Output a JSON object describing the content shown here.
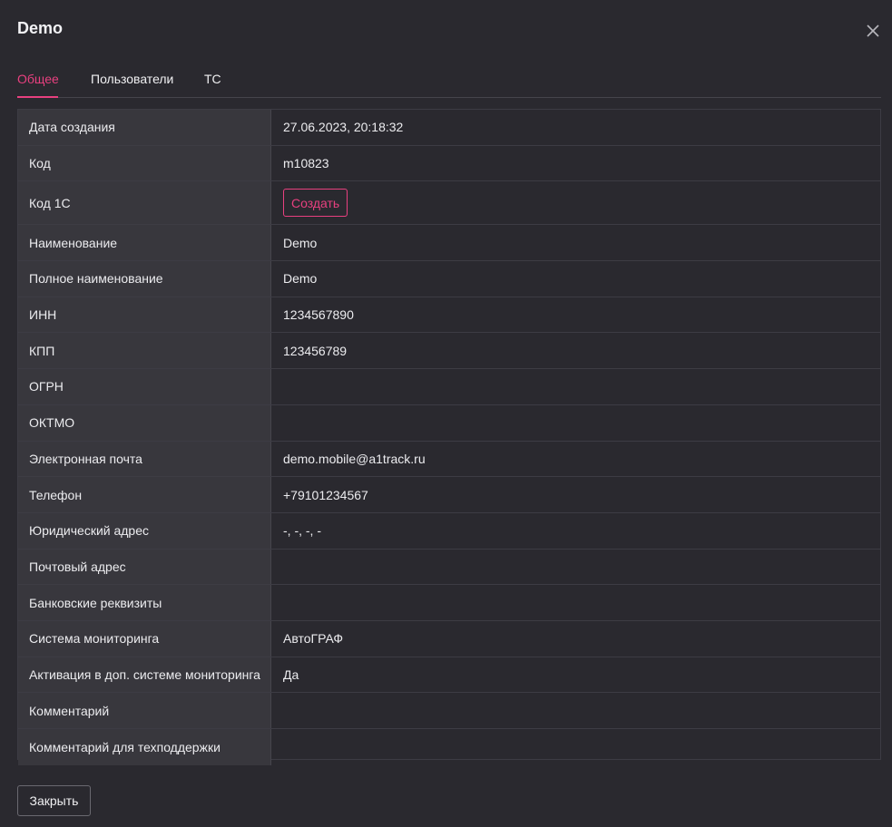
{
  "dialog": {
    "title": "Demo",
    "close_icon": "close-icon"
  },
  "tabs": [
    {
      "label": "Общее",
      "active": true
    },
    {
      "label": "Пользователи",
      "active": false
    },
    {
      "label": "ТС",
      "active": false
    }
  ],
  "fields": {
    "created": {
      "label": "Дата создания",
      "value": "27.06.2023, 20:18:32"
    },
    "code": {
      "label": "Код",
      "value": "m10823"
    },
    "code1c": {
      "label": "Код 1С",
      "button": "Создать"
    },
    "name": {
      "label": "Наименование",
      "value": "Demo"
    },
    "full_name": {
      "label": "Полное наименование",
      "value": "Demo"
    },
    "inn": {
      "label": "ИНН",
      "value": "1234567890"
    },
    "kpp": {
      "label": "КПП",
      "value": "123456789"
    },
    "ogrn": {
      "label": "ОГРН",
      "value": ""
    },
    "oktmo": {
      "label": "ОКТМО",
      "value": ""
    },
    "email": {
      "label": "Электронная почта",
      "value": "demo.mobile@a1track.ru"
    },
    "phone": {
      "label": "Телефон",
      "value": "+79101234567"
    },
    "legal_address": {
      "label": "Юридический адрес",
      "value": "-, -, -, -"
    },
    "postal_address": {
      "label": "Почтовый адрес",
      "value": ""
    },
    "bank": {
      "label": "Банковские реквизиты",
      "value": ""
    },
    "monitoring": {
      "label": "Система мониторинга",
      "value": "АвтоГРАФ"
    },
    "activation": {
      "label": "Активация в доп. системе мониторинга",
      "value": "Да"
    },
    "comment": {
      "label": "Комментарий",
      "value": ""
    },
    "support_comment": {
      "label": "Комментарий для техподдержки",
      "value": ""
    }
  },
  "footer": {
    "close_label": "Закрыть"
  },
  "colors": {
    "background": "#2a292f",
    "label_cell": "#38373d",
    "accent": "#e8407f",
    "border": "#3d3c44"
  }
}
